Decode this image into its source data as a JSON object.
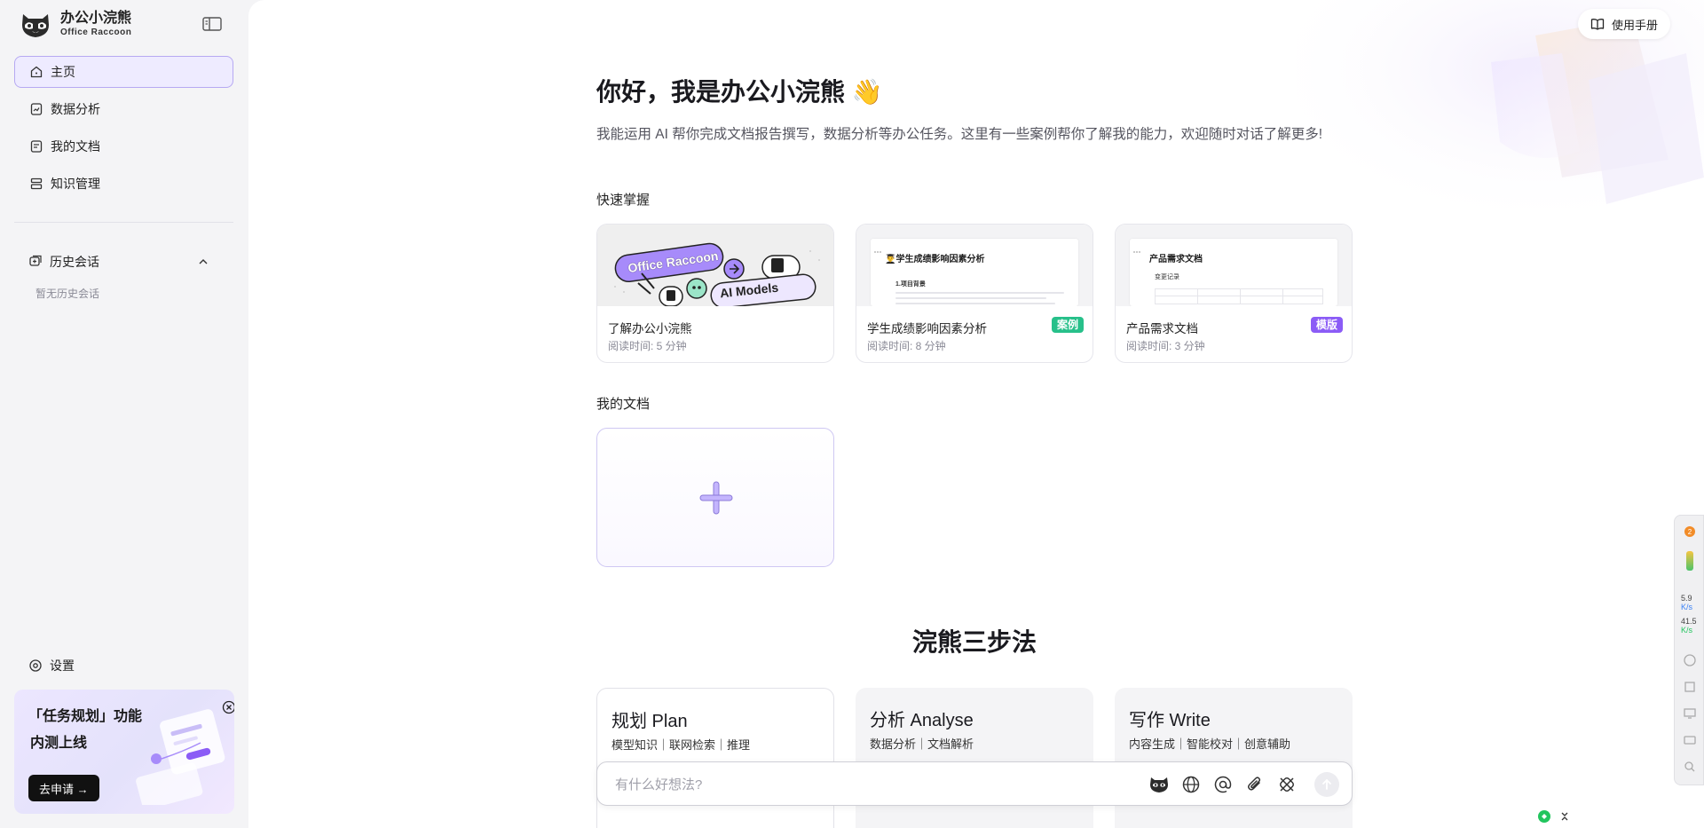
{
  "brand": {
    "title": "办公小浣熊",
    "subtitle": "Office Raccoon"
  },
  "nav": [
    {
      "label": "主页",
      "icon": "home-icon",
      "active": true
    },
    {
      "label": "数据分析",
      "icon": "chart-file-icon"
    },
    {
      "label": "我的文档",
      "icon": "document-icon"
    },
    {
      "label": "知识管理",
      "icon": "knowledge-icon"
    }
  ],
  "history": {
    "label": "历史会话",
    "empty": "暂无历史会话"
  },
  "settings": {
    "label": "设置"
  },
  "promo": {
    "title_line1": "「任务规划」功能",
    "title_line2": "内测上线",
    "button": "去申请 →"
  },
  "header": {
    "manual": "使用手册"
  },
  "main": {
    "greeting": "你好，我是办公小浣熊 👋",
    "intro": "我能运用 AI 帮你完成文档报告撰写，数据分析等办公任务。这里有一些案例帮你了解我的能力，欢迎随时对话了解更多!",
    "quick_label": "快速掌握",
    "cards": [
      {
        "title": "了解办公小浣熊",
        "meta": "阅读时间: 5 分钟",
        "badge": "",
        "thumb_text1": "Office Raccoon",
        "thumb_text2": "AI Models"
      },
      {
        "title": "学生成绩影响因素分析",
        "meta": "阅读时间: 8 分钟",
        "badge": "案例",
        "thumb_title": "👨‍🎓学生成绩影响因素分析",
        "thumb_sub": "1.项目背景"
      },
      {
        "title": "产品需求文档",
        "meta": "阅读时间: 3 分钟",
        "badge": "模版",
        "thumb_title": "产品需求文档",
        "thumb_sub": "变更记录"
      }
    ],
    "my_docs_label": "我的文档",
    "steps_title": "浣熊三步法",
    "steps": [
      {
        "title": "规划 Plan",
        "sub": "模型知识｜联网检索｜推理"
      },
      {
        "title": "分析 Analyse",
        "sub": "数据分析｜文档解析"
      },
      {
        "title": "写作 Write",
        "sub": "内容生成｜智能校对｜创意辅助"
      }
    ],
    "composer": {
      "placeholder": "有什么好想法?"
    }
  },
  "system_widget": {
    "up_value": "5.9",
    "up_unit": "K/s",
    "down_value": "41.5",
    "down_unit": "K/s"
  },
  "colors": {
    "accent": "#8b5cf6",
    "active_bg": "#eeebff",
    "green_badge": "#27c08a"
  }
}
